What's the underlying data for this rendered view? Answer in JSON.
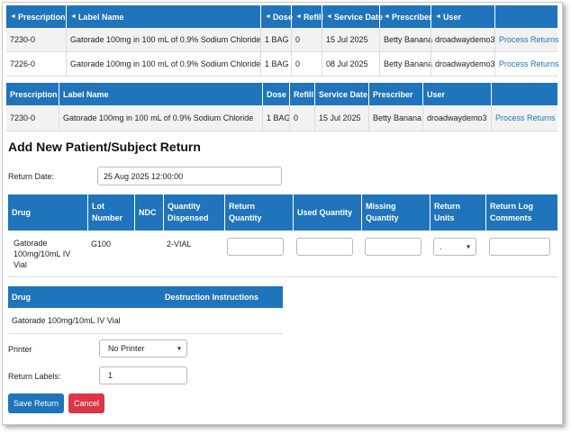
{
  "table1": {
    "headers": [
      "Prescription",
      "Label Name",
      "Dose",
      "Refill",
      "Service Date",
      "Prescriber",
      "User",
      ""
    ],
    "rows": [
      [
        "7230-0",
        "Gatorade 100mg in 100 mL of 0.9% Sodium Chloride",
        "1 BAG",
        "0",
        "15 Jul 2025",
        "Betty Banana",
        "droadwaydemo3",
        "Process Returns"
      ],
      [
        "7226-0",
        "Gatorade 100mg in 100 mL of 0.9% Sodium Chloride",
        "1 BAG",
        "0",
        "08 Jul 2025",
        "Betty Banana",
        "droadwaydemo3",
        "Process Returns"
      ]
    ]
  },
  "table2": {
    "headers": [
      "Prescription",
      "Label Name",
      "Dose",
      "Refill",
      "Service Date",
      "Prescriber",
      "User",
      ""
    ],
    "rows": [
      [
        "7230-0",
        "Gatorade 100mg in 100 mL of 0.9% Sodium Chloride",
        "1 BAG",
        "0",
        "15 Jul 2025",
        "Betty Banana",
        "droadwaydemo3",
        "Process Returns"
      ]
    ]
  },
  "section_title": "Add New Patient/Subject Return",
  "return_date": {
    "label": "Return Date:",
    "value": "25 Aug 2025 12:00:00"
  },
  "drug_table": {
    "headers": {
      "drug": "Drug",
      "lot_line1": "Lot",
      "lot_line2": "Number",
      "ndc": "NDC",
      "qd_line1": "Quantity",
      "qd_line2": "Dispensed",
      "rq_line1": "Return",
      "rq_line2": "Quantity",
      "used": "Used Quantity",
      "mq_line1": "Missing",
      "mq_line2": "Quantity",
      "ru_line1": "Return",
      "ru_line2": "Units",
      "rl_line1": "Return Log",
      "rl_line2": "Comments"
    },
    "row": {
      "drug_line1": "Gatorade",
      "drug_line2": "100mg/10mL IV",
      "drug_line3": "Vial",
      "lot": "G100",
      "ndc": "",
      "qty_dispensed": "2-VIAL",
      "units_selected": "."
    }
  },
  "destruction": {
    "header_drug": "Drug",
    "header_instructions": "Destruction Instructions",
    "drug": "Gatorade 100mg/10mL IV Vial",
    "instructions": ""
  },
  "printer": {
    "label": "Printer",
    "value": "No Printer"
  },
  "labels": {
    "label": "Return Labels:",
    "value": "1"
  },
  "buttons": {
    "save": "Save Return",
    "cancel": "Cancel"
  },
  "colors": {
    "header": "#1f74bb",
    "save": "#1f74bb",
    "cancel": "#dc3545",
    "link": "#1f74bb"
  }
}
